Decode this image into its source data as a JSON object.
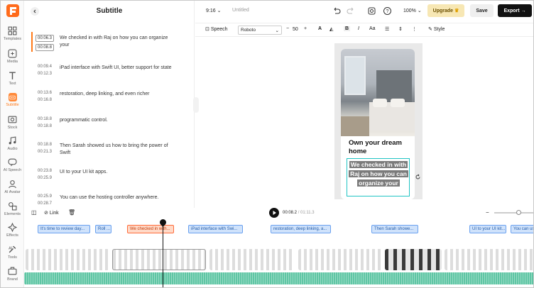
{
  "rail": {
    "items": [
      {
        "label": "Templates",
        "icon": "templates-icon"
      },
      {
        "label": "Media",
        "icon": "media-icon"
      },
      {
        "label": "Text",
        "icon": "text-icon"
      },
      {
        "label": "Subtitle",
        "icon": "subtitle-icon",
        "active": true
      },
      {
        "label": "Stock",
        "icon": "stock-icon"
      },
      {
        "label": "Audio",
        "icon": "audio-icon"
      },
      {
        "label": "AI Speech",
        "icon": "ai-speech-icon"
      },
      {
        "label": "AI Avatar",
        "icon": "ai-avatar-icon"
      },
      {
        "label": "Elements",
        "icon": "elements-icon"
      },
      {
        "label": "Effects",
        "icon": "effects-icon"
      },
      {
        "label": "Tools",
        "icon": "tools-icon"
      },
      {
        "label": "Brand",
        "icon": "brand-icon"
      }
    ]
  },
  "panel": {
    "title": "Subtitle",
    "rows": [
      {
        "start": "00:06.3",
        "end": "00:08.8",
        "text": "We checked in with Raj on how you can organize your",
        "active": true
      },
      {
        "start": "00:09.4",
        "end": "00:12.3",
        "text": "iPad interface with Swift UI, better support for state"
      },
      {
        "start": "00:13.6",
        "end": "00:16.8",
        "text": "restoration, deep linking, and even richer"
      },
      {
        "start": "00:18.8",
        "end": "00:18.8",
        "text": "programmatic control."
      },
      {
        "start": "00:18.8",
        "end": "00:21.3",
        "text": "Then Sarah showed us how to bring the power of Swift"
      },
      {
        "start": "00:23.8",
        "end": "00:25.9",
        "text": "UI to your UI kit apps."
      },
      {
        "start": "00:25.9",
        "end": "00:28.7",
        "text": "You can use the hosting controller anywhere."
      }
    ]
  },
  "topbar": {
    "ratio": "9:16",
    "project_name": "Untitled",
    "zoom": "100%",
    "upgrade": "Upgrade",
    "save": "Save",
    "export": "Export"
  },
  "format": {
    "speech": "Speech",
    "font": "Roboto",
    "size": "50",
    "style": "Style"
  },
  "canvas": {
    "card_title": "Own your dream home",
    "caption": "We checked in with Raj on how you can organize your"
  },
  "timeline": {
    "link": "Link",
    "current": "00:08.2",
    "total": "01:11.3",
    "zoom_level": 0.6,
    "subtitle_chips": [
      {
        "text": "It's time to review day..."
      },
      {
        "text": "Roll ..."
      },
      {
        "text": "We checked in with...",
        "active": true
      },
      {
        "text": "iPad interface with Swi..."
      },
      {
        "text": "restoration, deep linking, a..."
      },
      {
        "text": "Then Sarah showe..."
      },
      {
        "text": "UI to your UI kit..."
      },
      {
        "text": "You can us..."
      }
    ]
  }
}
